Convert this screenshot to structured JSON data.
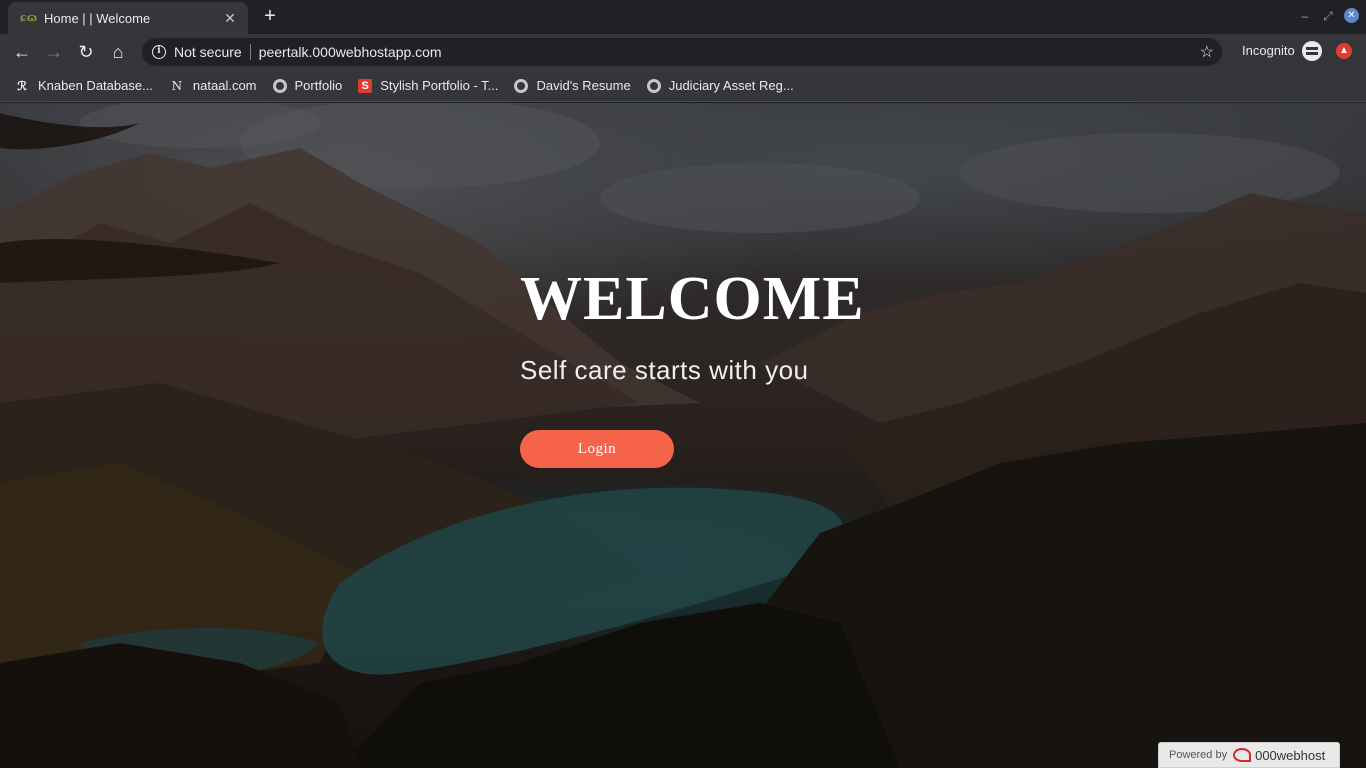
{
  "browser": {
    "tab_title": "Home | | Welcome",
    "tab_close": "✕",
    "new_tab": "+",
    "security_label": "Not secure",
    "url": "peertalk.000webhostapp.com",
    "profile_label": "Incognito",
    "window_controls": {
      "minimize": "–",
      "restore": "⤢",
      "close": "✕"
    }
  },
  "bookmarks": [
    {
      "label": "Knaben Database...",
      "icon": "knaben-icon"
    },
    {
      "label": "nataal.com",
      "icon": "nataal-icon"
    },
    {
      "label": "Portfolio",
      "icon": "globe-icon"
    },
    {
      "label": "Stylish Portfolio - T...",
      "icon": "s-icon"
    },
    {
      "label": "David's Resume",
      "icon": "globe-icon"
    },
    {
      "label": "Judiciary Asset Reg...",
      "icon": "globe-icon"
    }
  ],
  "hero": {
    "title": "WELCOME",
    "subtitle": "Self care starts with you",
    "login_label": "Login",
    "login_color": "#f5644a"
  },
  "footer_badge": {
    "powered_label": "Powered by",
    "brand": "000webhost"
  }
}
